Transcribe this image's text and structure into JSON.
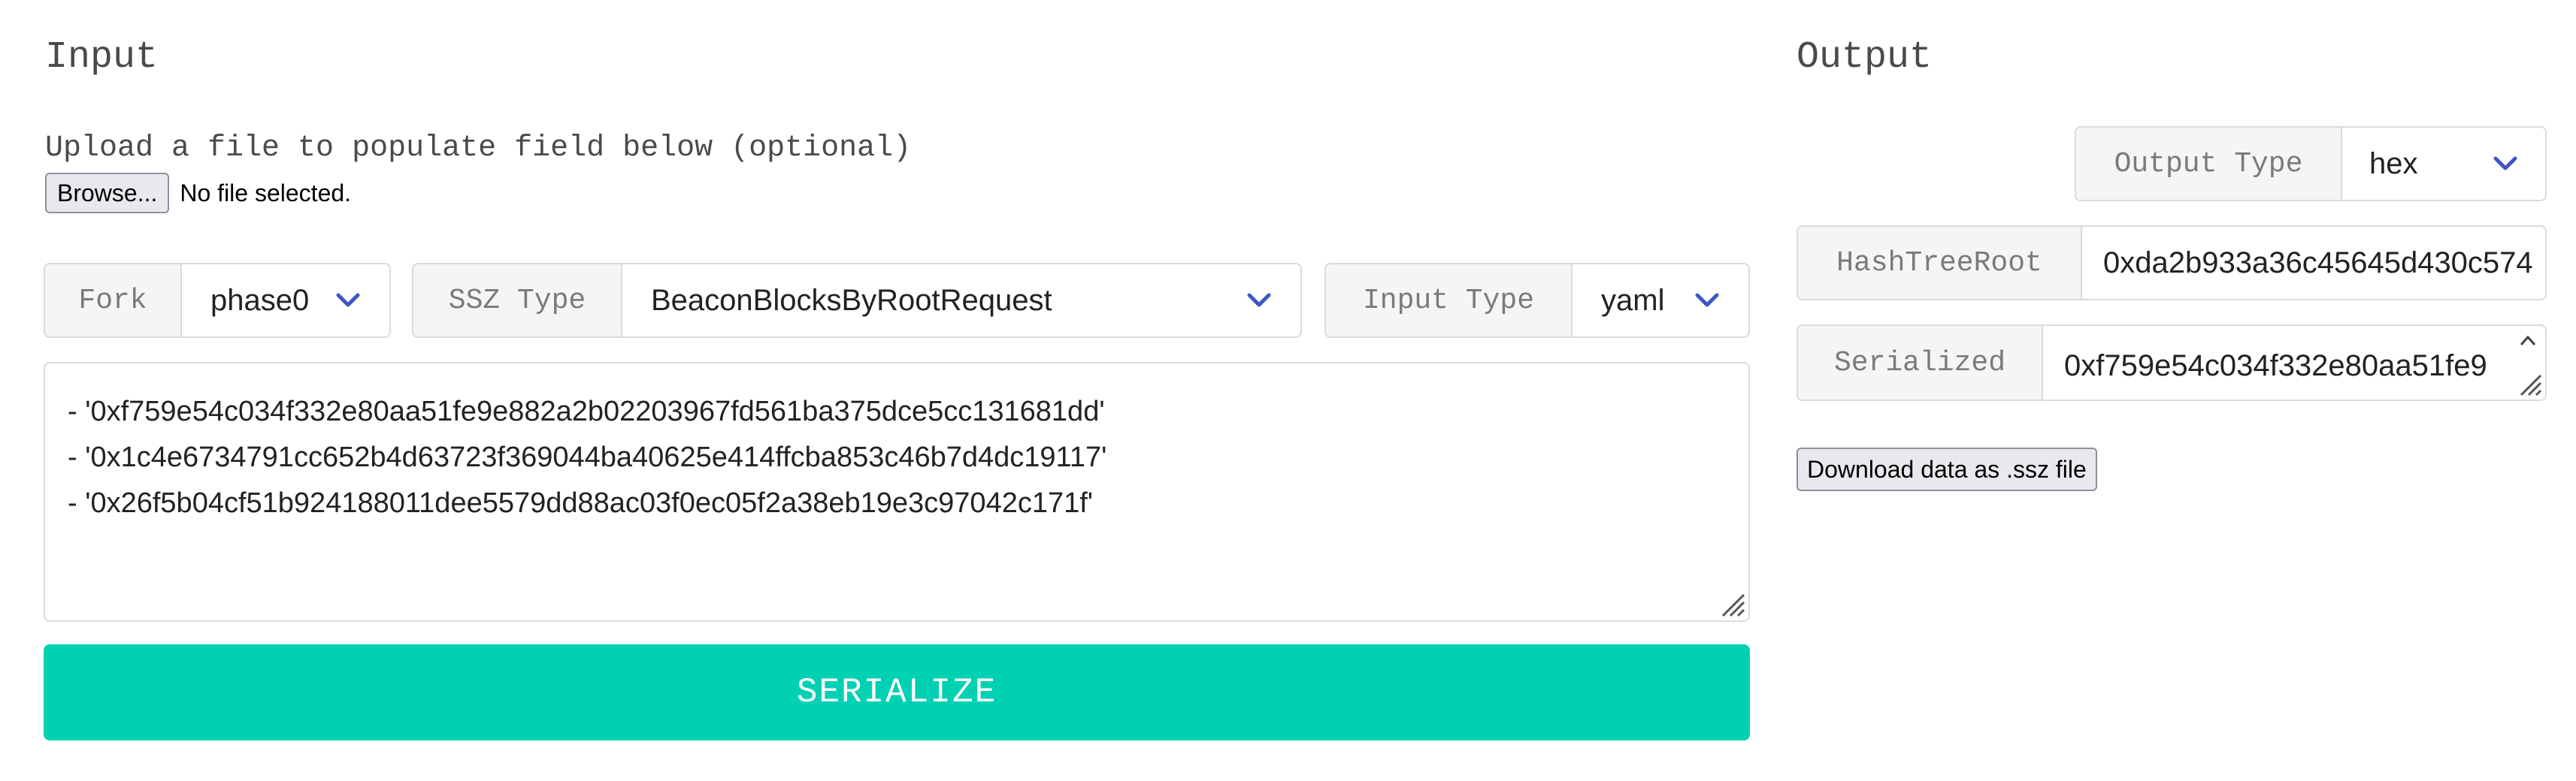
{
  "input": {
    "title": "Input",
    "upload_label": "Upload a file to populate field below (optional)",
    "browse_label": "Browse...",
    "file_status": "No file selected.",
    "fork": {
      "label": "Fork",
      "value": "phase0"
    },
    "ssz_type": {
      "label": "SSZ Type",
      "value": "BeaconBlocksByRootRequest"
    },
    "input_type": {
      "label": "Input Type",
      "value": "yaml"
    },
    "lines": [
      "- '0xf759e54c034f332e80aa51fe9e882a2b02203967fd561ba375dce5cc131681dd'",
      "- '0x1c4e6734791cc652b4d63723f369044ba40625e414ffcba853c46b7d4dc19117'",
      "- '0x26f5b04cf51b924188011dee5579dd88ac03f0ec05f2a38eb19e3c97042c171f'"
    ],
    "serialize_label": "SERIALIZE"
  },
  "output": {
    "title": "Output",
    "output_type": {
      "label": "Output Type",
      "value": "hex"
    },
    "hash_tree_root": {
      "label": "HashTreeRoot",
      "value": "0xda2b933a36c45645d430c574"
    },
    "serialized": {
      "label": "Serialized",
      "value": "0xf759e54c034f332e80aa51fe9"
    },
    "download_label": "Download data as .ssz file"
  },
  "colors": {
    "accent": "#00d1b2",
    "chevron": "#3e56c4",
    "border": "#dbdbdb",
    "addon_bg": "#f5f5f5"
  },
  "icons": {
    "select_arrow": "chevron-down-icon",
    "resize": "resize-grip-icon"
  }
}
